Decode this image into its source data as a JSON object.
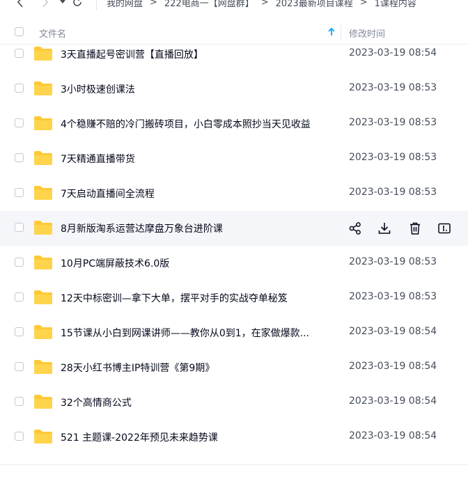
{
  "breadcrumb": {
    "items": [
      "我的网盘",
      "222电商一【网盘群】",
      "2023最新项目课程",
      "1课程内容"
    ],
    "separator": ">"
  },
  "table": {
    "header_name": "文件名",
    "header_time": "修改时间",
    "sort": "ascending",
    "rows": [
      {
        "name": "3天直播起号密训营【直播回放】",
        "time": "2023-03-19 08:54"
      },
      {
        "name": "3小时极速创课法",
        "time": "2023-03-19 08:53"
      },
      {
        "name": "4个稳赚不赔的冷门搬砖项目，小白零成本照抄当天见收益",
        "time": "2023-03-19 08:53"
      },
      {
        "name": "7天精通直播带货",
        "time": "2023-03-19 08:53"
      },
      {
        "name": "7天启动直播间全流程",
        "time": "2023-03-19 08:53"
      },
      {
        "name": "8月新版淘系运营达摩盘万象台进阶课",
        "time": ""
      },
      {
        "name": "10月PC端屏蔽技术6.0版",
        "time": "2023-03-19 08:53"
      },
      {
        "name": "12天中标密训—拿下大单，摆平对手的实战夺单秘笈",
        "time": "2023-03-19 08:53"
      },
      {
        "name": "15节课从小白到网课讲师——教你从0到1，在家做爆款...",
        "time": "2023-03-19 08:54"
      },
      {
        "name": "28天小红书博主IP特训营《第9期》",
        "time": "2023-03-19 08:54"
      },
      {
        "name": "32个高情商公式",
        "time": "2023-03-19 08:54"
      },
      {
        "name": "521 主题课-2022年预见未来趋势课",
        "time": "2023-03-19 08:54"
      }
    ]
  },
  "icons": {
    "folder": "folder-icon",
    "share": "share-icon",
    "download": "download-icon",
    "delete": "trash-icon",
    "rename": "rename-icon"
  },
  "colors": {
    "folder": "#ffc936",
    "accent": "#06a7ff",
    "hover_row": "#f5f6f9"
  }
}
